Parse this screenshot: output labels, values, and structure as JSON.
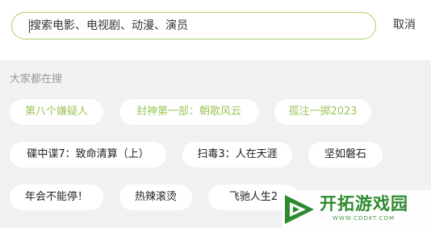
{
  "search": {
    "placeholder": "搜索电影、电视剧、动漫、演员",
    "value": "",
    "cancel_label": "取消"
  },
  "trending": {
    "title": "大家都在搜",
    "items": [
      {
        "label": "第八个嫌疑人",
        "highlighted": true
      },
      {
        "label": "封神第一部：朝歌风云",
        "highlighted": true
      },
      {
        "label": "孤注一掷2023",
        "highlighted": true
      },
      {
        "label": "碟中谍7：致命清算（上）",
        "highlighted": false
      },
      {
        "label": "扫毒3：人在天涯",
        "highlighted": false
      },
      {
        "label": "坚如磐石",
        "highlighted": false
      },
      {
        "label": "年会不能停！",
        "highlighted": false
      },
      {
        "label": "热辣滚烫",
        "highlighted": false
      },
      {
        "label": "飞驰人生2",
        "highlighted": false
      }
    ]
  },
  "watermark": {
    "title": "开拓游戏园",
    "url": "WWW.CDDKT.COM"
  },
  "colors": {
    "accent": "#9bc55a",
    "search_border": "#a9cf6a",
    "background": "#f1f1f1",
    "chip_bg": "#ffffff",
    "muted_text": "#999999",
    "watermark_green": "#2f8a2f"
  }
}
